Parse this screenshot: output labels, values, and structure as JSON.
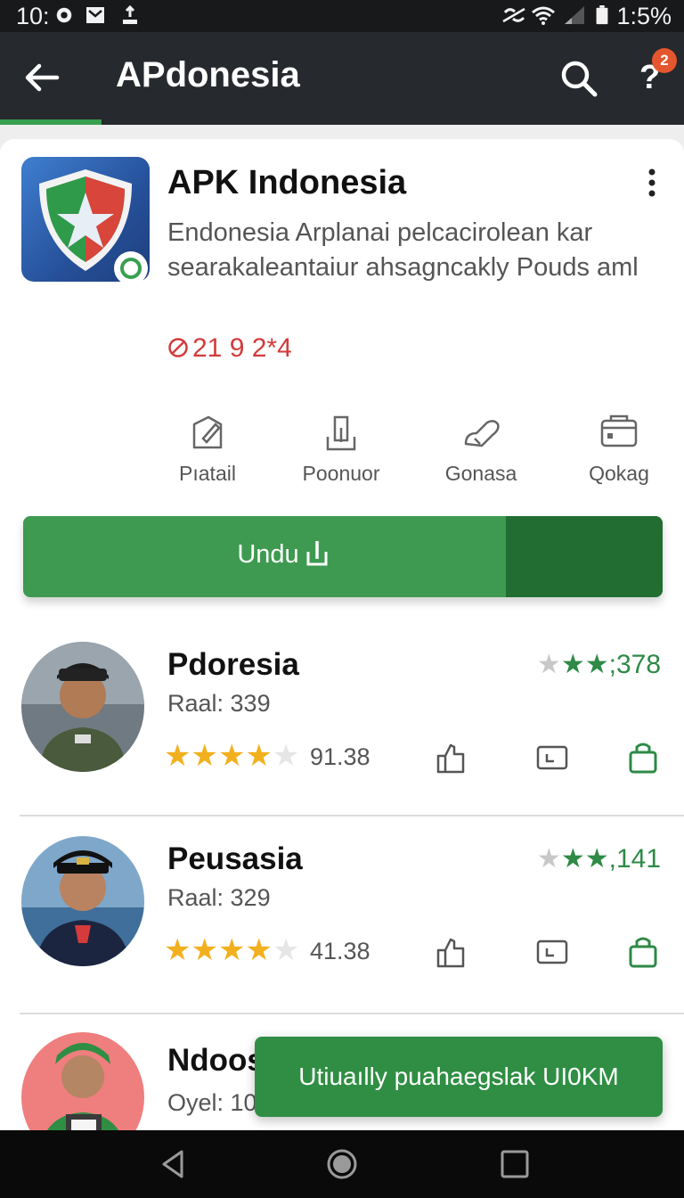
{
  "status_bar": {
    "time": "10:",
    "battery_text": "1:5%"
  },
  "app_bar": {
    "title": "APdonesia",
    "help_symbol": "?",
    "notification_count": "2",
    "accent": "#37a04f"
  },
  "app": {
    "name": "APK Indonesia",
    "description": "Endonesia Arplanai pelcacirolean kar searakaleantaiur ahsagncakly Pouds aml",
    "date": "21 9 2*4",
    "actions": [
      {
        "label": "Pıatail",
        "icon": "edit-tag-icon"
      },
      {
        "label": "Poonuor",
        "icon": "download-tray-icon"
      },
      {
        "label": "Gonasa",
        "icon": "cloud-edit-icon"
      },
      {
        "label": "Qokag",
        "icon": "calendar-icon"
      }
    ],
    "download_label": "Undu",
    "primary_color": "#3e9a50"
  },
  "list": {
    "items": [
      {
        "name": "Pdoresia",
        "sub": "Raal: 339",
        "score": "91.38",
        "rating_count": ";378",
        "rating_stars": 4
      },
      {
        "name": "Peusasia",
        "sub": "Raal: 329",
        "score": "41.38",
        "rating_count": ",141",
        "rating_stars": 4
      },
      {
        "name": "Ndoos",
        "sub": "Oyel: 103"
      }
    ]
  },
  "snackbar": {
    "text": "Utiuaılly puahaegslak UI0KM"
  }
}
